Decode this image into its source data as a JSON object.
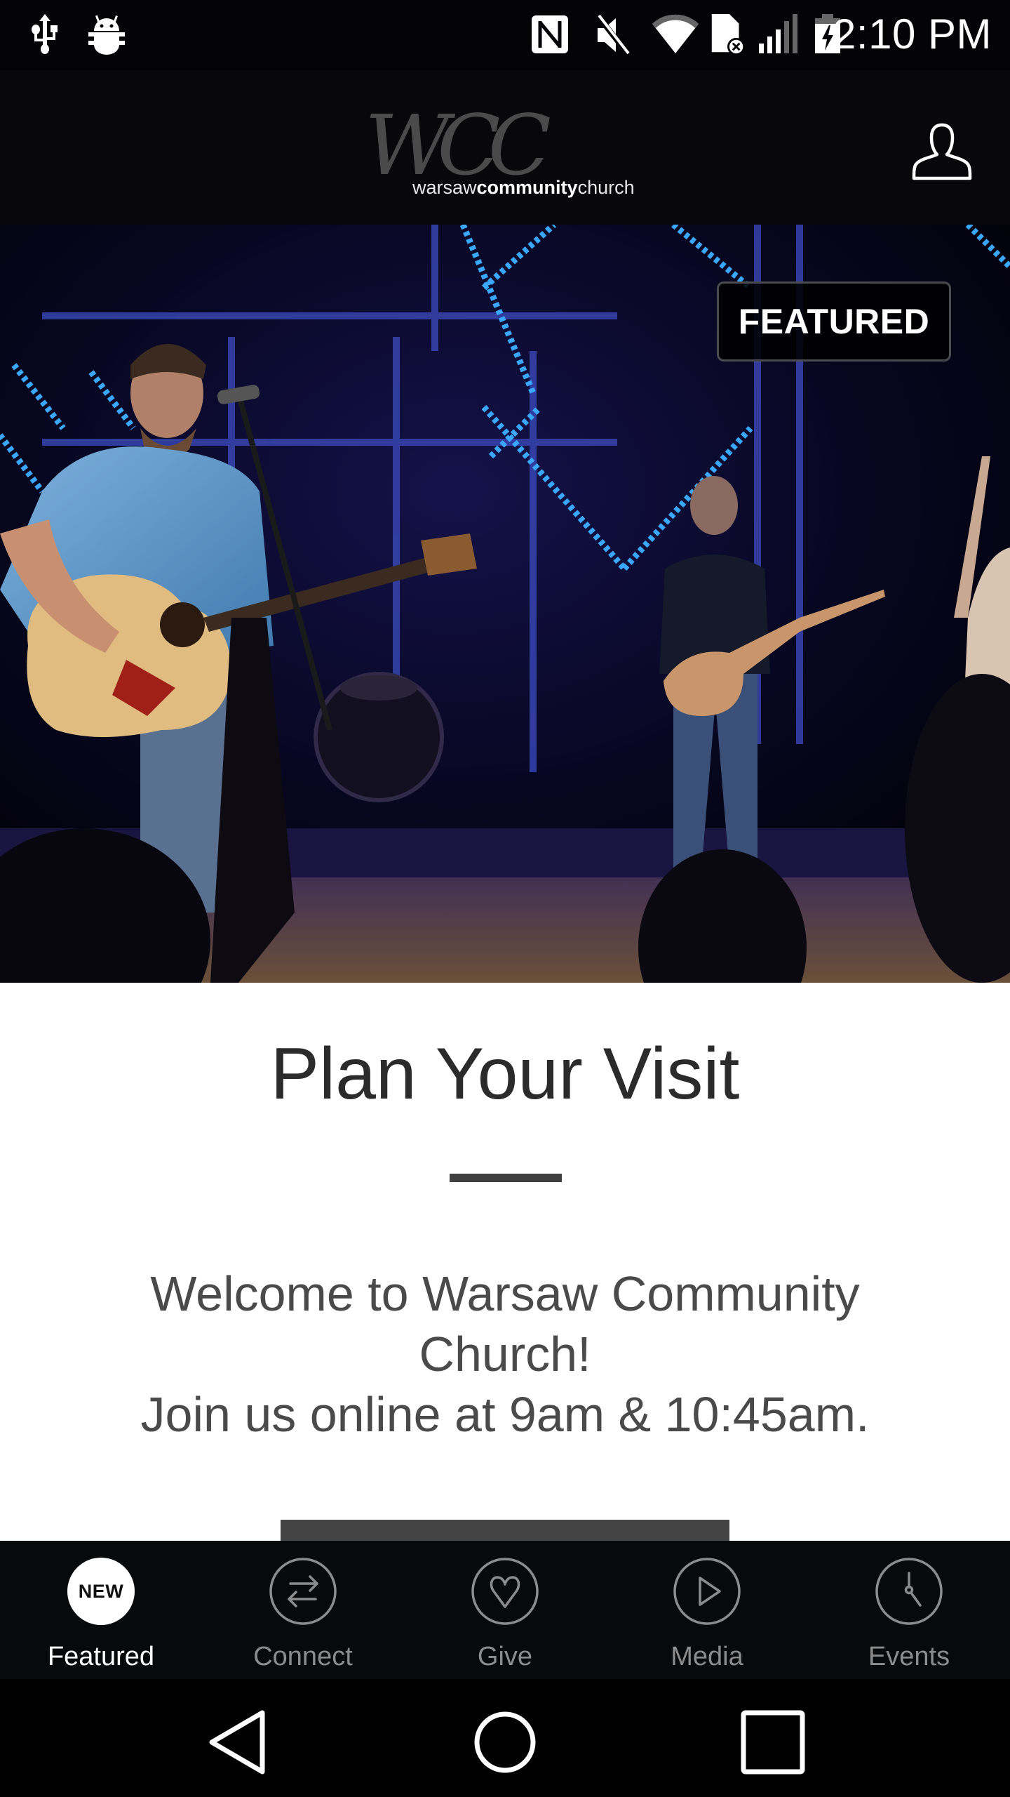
{
  "status_bar": {
    "time": "2:10 PM",
    "left_icons": [
      "usb-icon",
      "android-debug-icon"
    ],
    "right_icons": [
      "nfc-icon",
      "mute-icon",
      "wifi-icon",
      "no-sim-icon",
      "cell-signal-icon",
      "battery-charging-icon"
    ]
  },
  "header": {
    "logo_script": "WCC",
    "logo_word_1": "warsaw",
    "logo_word_2": "community",
    "logo_word_3": "church",
    "profile_icon": "user-icon"
  },
  "hero": {
    "badge": "FEATURED",
    "image_description": "worship band performing on stage with blue lights"
  },
  "content": {
    "title": "Plan Your Visit",
    "welcome_line_1": "Welcome to Warsaw Community Church!",
    "welcome_line_2": "Join us online at 9am & 10:45am."
  },
  "tabs": [
    {
      "label": "Featured",
      "icon": "new-badge-icon",
      "badge": "NEW",
      "active": true
    },
    {
      "label": "Connect",
      "icon": "swap-arrows-icon",
      "active": false
    },
    {
      "label": "Give",
      "icon": "heart-icon",
      "active": false
    },
    {
      "label": "Media",
      "icon": "play-icon",
      "active": false
    },
    {
      "label": "Events",
      "icon": "clock-icon",
      "active": false
    }
  ],
  "colors": {
    "header_bg": "#08080a",
    "tab_active": "#ffffff",
    "tab_inactive": "#8c8c8c",
    "title_text": "#2b2b2b",
    "body_text": "#4a4a4a",
    "button_bg": "#444444"
  },
  "nav": {
    "back": "back-icon",
    "home": "home-icon",
    "recents": "recents-icon"
  }
}
